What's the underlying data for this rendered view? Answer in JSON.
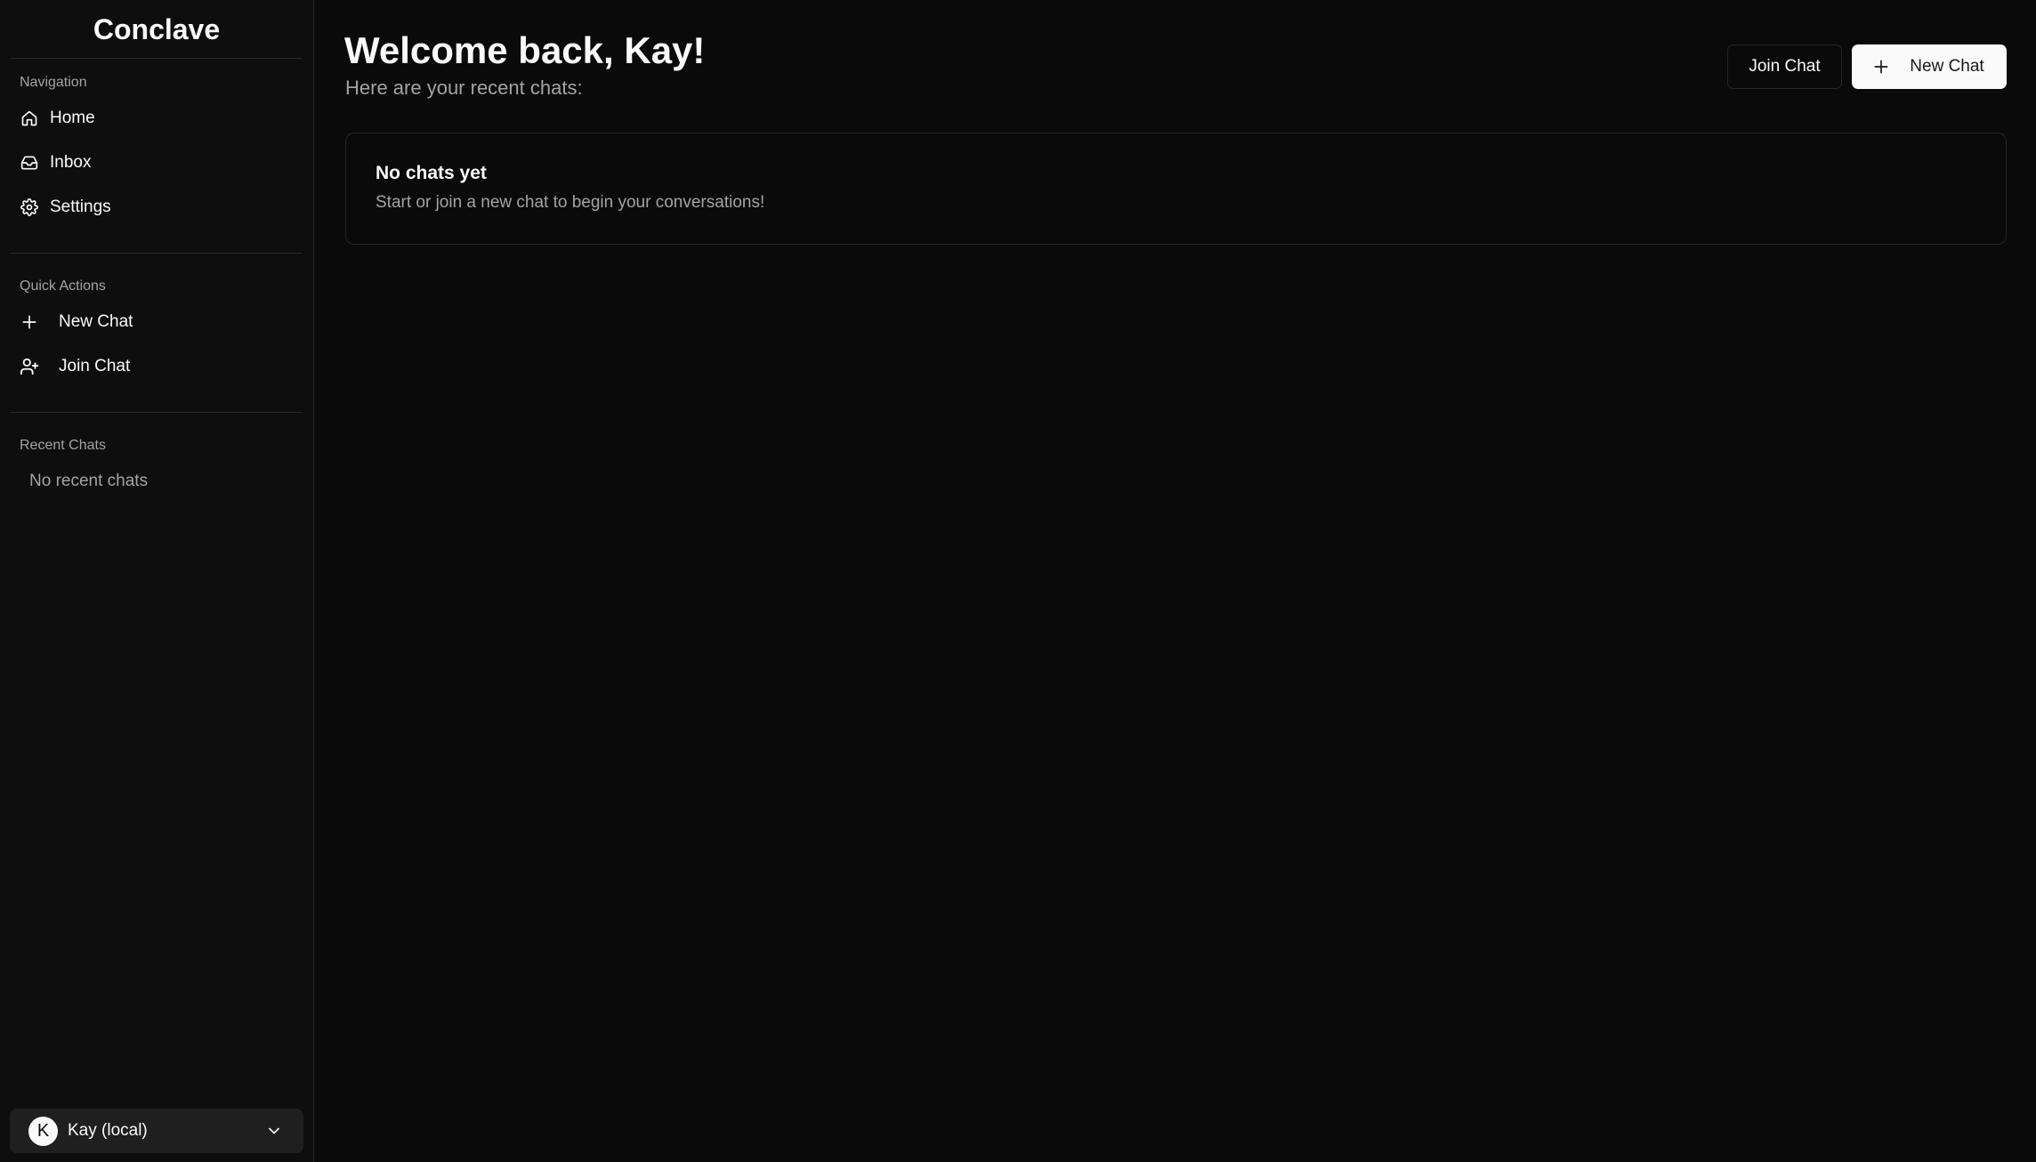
{
  "app": {
    "name": "Conclave"
  },
  "sidebar": {
    "navigation_label": "Navigation",
    "nav_items": [
      {
        "label": "Home",
        "icon": "home-icon"
      },
      {
        "label": "Inbox",
        "icon": "inbox-icon"
      },
      {
        "label": "Settings",
        "icon": "gear-icon"
      }
    ],
    "quick_actions_label": "Quick Actions",
    "quick_actions": [
      {
        "label": "New Chat",
        "icon": "plus-icon"
      },
      {
        "label": "Join Chat",
        "icon": "user-plus-icon"
      }
    ],
    "recent_label": "Recent Chats",
    "recent_empty": "No recent chats",
    "user": {
      "initial": "K",
      "name": "Kay (local)"
    }
  },
  "main": {
    "title": "Welcome back, Kay!",
    "subtitle": "Here are your recent chats:",
    "join_button": "Join Chat",
    "new_button": "New Chat",
    "empty_state": {
      "title": "No chats yet",
      "description": "Start or join a new chat to begin your conversations!"
    }
  },
  "colors": {
    "background": "#0a0a0a",
    "sidebar": "#0e0e0e",
    "border": "#262626",
    "text": "#fafafa",
    "muted": "#a3a3a3",
    "primary_button": "#fafafa"
  }
}
